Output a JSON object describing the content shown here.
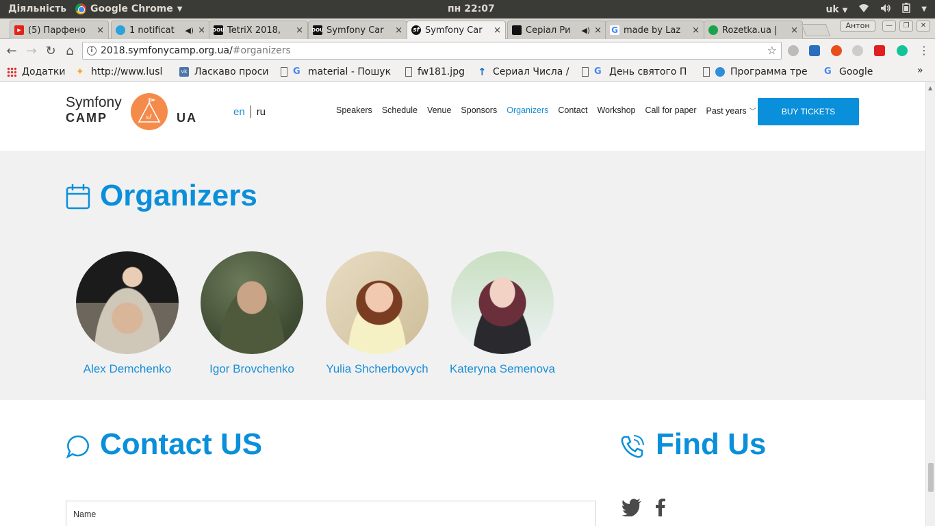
{
  "os": {
    "activities": "Діяльність",
    "app_name": "Google Chrome",
    "clock": "пн 22:07",
    "keyboard": "uk"
  },
  "tabs": [
    {
      "title": "(5) Парфено",
      "fav_color": "#e62117",
      "speaker": false
    },
    {
      "title": "1 notificat",
      "fav_color": "#2aa2dc",
      "speaker": true
    },
    {
      "title": "TetriX 2018,",
      "fav_color": "#111111",
      "speaker": false
    },
    {
      "title": "Symfony Car",
      "fav_color": "#111111",
      "speaker": false
    },
    {
      "title": "Symfony Car",
      "fav_color": "#111111",
      "speaker": false,
      "active": true
    },
    {
      "title": "Серіал Ри",
      "fav_color": "#111111",
      "speaker": true
    },
    {
      "title": "made by Laz",
      "fav_color": "#4285f4",
      "speaker": false
    },
    {
      "title": "Rozetka.ua |",
      "fav_color": "#1aa34a",
      "speaker": false
    }
  ],
  "window": {
    "profile": "Антон"
  },
  "toolbar": {
    "url_host": "2018.symfonycamp.org.ua/",
    "url_hash": "#organizers"
  },
  "bookmarks": [
    {
      "label": "Додатки",
      "icon": "apps-grid-icon"
    },
    {
      "label": "http://www.lusl",
      "icon": "bulb-icon"
    },
    {
      "label": "Ласкаво проси",
      "icon": "vk-icon"
    },
    {
      "label": "material - Пошук",
      "icon": "google-icon"
    },
    {
      "label": "fw181.jpg",
      "icon": "file-icon"
    },
    {
      "label": "Сериал Числа /",
      "icon": "arrow-up-icon"
    },
    {
      "label": "День святого П",
      "icon": "google-icon"
    },
    {
      "label": "Программа тре",
      "icon": "globe-icon"
    },
    {
      "label": "Google",
      "icon": "google-icon"
    }
  ],
  "site": {
    "logo_line1": "Symfony",
    "logo_line2": "CAMP",
    "logo_line3": "UA",
    "lang_en": "en",
    "lang_ru": "ru",
    "nav": [
      "Speakers",
      "Schedule",
      "Venue",
      "Sponsors",
      "Organizers",
      "Contact",
      "Workshop",
      "Call for paper",
      "Past years"
    ],
    "active_nav": "Organizers",
    "buy_label": "BUY TICKETS",
    "accent_color": "#0a8fda"
  },
  "organizers": {
    "title": "Organizers",
    "people": [
      {
        "name": "Alex Demchenko"
      },
      {
        "name": "Igor Brovchenko"
      },
      {
        "name": "Yulia Shcherbovych"
      },
      {
        "name": "Kateryna Semenova"
      }
    ]
  },
  "contact": {
    "title": "Contact US",
    "name_label": "Name",
    "find_title": "Find Us"
  }
}
